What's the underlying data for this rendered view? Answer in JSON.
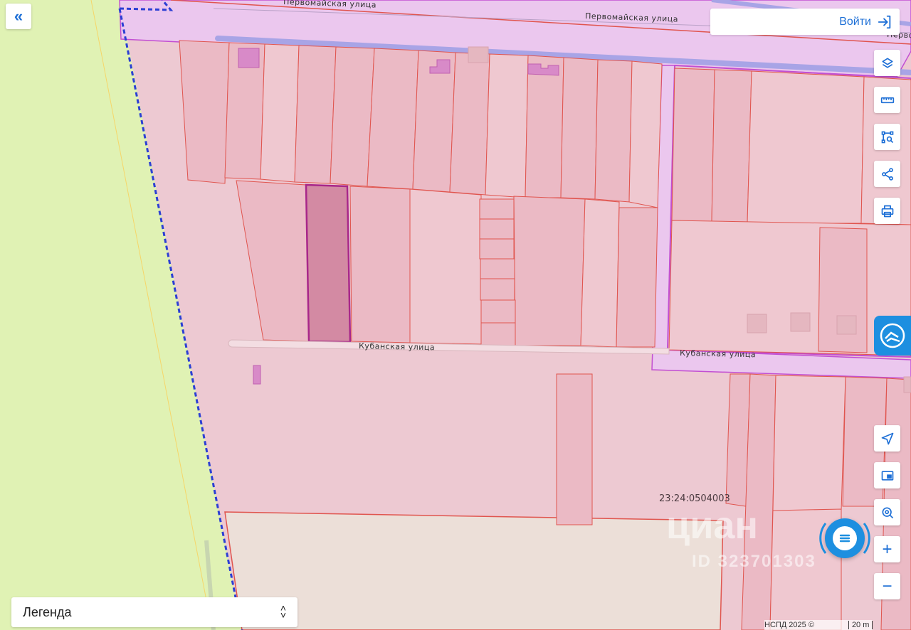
{
  "header": {
    "login_label": "Войти"
  },
  "streets": {
    "pervomayskaya": "Первомайская улица",
    "pervomayskaya_top": "Первомайская улица",
    "pervomayskaya_right": "Первом",
    "kubanskaya_left": "Кубанская улица",
    "kubanskaya_right": "Кубанская улица"
  },
  "cadastral_block": "23:24:0504003",
  "watermark": {
    "brand": "циан",
    "id": "ID 323701303"
  },
  "legend": {
    "label": "Легенда"
  },
  "attribution": {
    "source": "НСПД 2025 ©",
    "scale": "20 m"
  },
  "toolbar": {
    "zoom_in": "+",
    "zoom_out": "−"
  },
  "colors": {
    "accent": "#1d6fd6",
    "parcel_fill": "#edc6cf",
    "parcel_stroke": "#e0554f",
    "selected_parcel": "#d38aa3",
    "road_zone": "#ebc7ee",
    "green_zone": "#e0f2b4"
  }
}
